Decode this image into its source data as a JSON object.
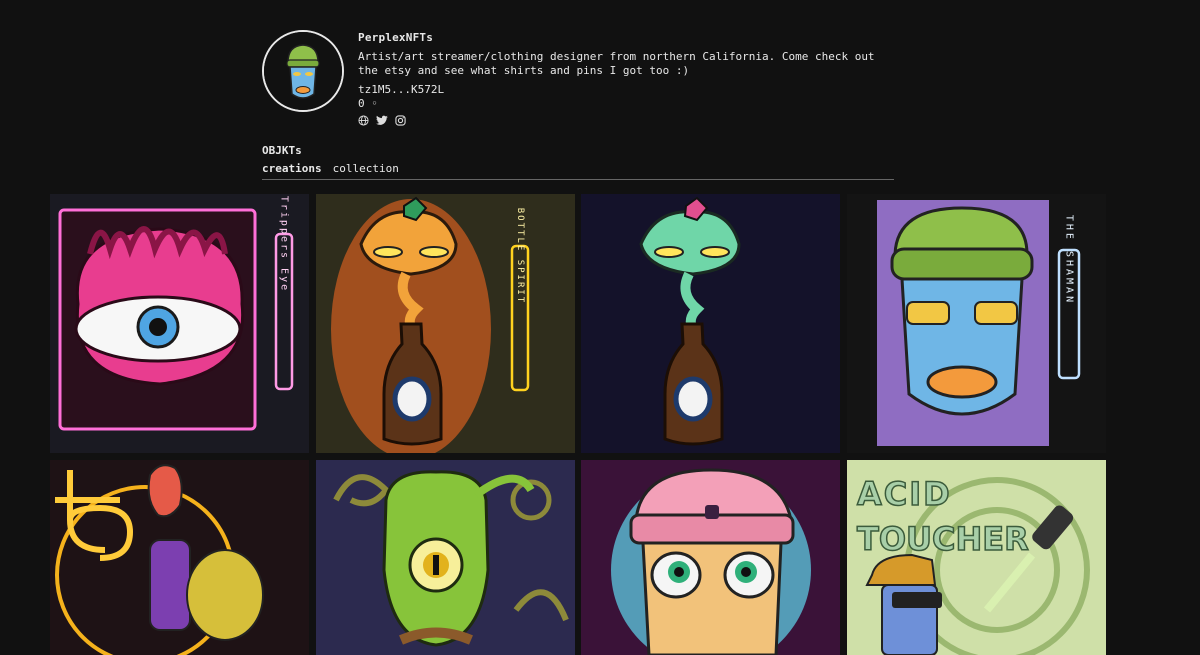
{
  "profile": {
    "name": "PerplexNFTs",
    "bio": "Artist/art streamer/clothing designer from northern California. Come check out the etsy and see what shirts and pins I got too :)",
    "wallet": "tz1M5...K572L",
    "count": "0 ◦",
    "socials": [
      {
        "name": "website",
        "icon": "globe-icon"
      },
      {
        "name": "twitter",
        "icon": "twitter-icon"
      },
      {
        "name": "instagram",
        "icon": "instagram-icon"
      }
    ]
  },
  "section_title": "OBJKTs",
  "tabs": {
    "creations": "creations",
    "collection": "collection",
    "active": "creations"
  },
  "artworks": [
    {
      "id": 1,
      "neon_text": "Trippers Eye",
      "bg": "#1a1a22",
      "accent": "#ff4fd2"
    },
    {
      "id": 2,
      "neon_text": "BOTTLE SPIRIT",
      "bg": "#2f2d1c",
      "accent": "#ffd21f"
    },
    {
      "id": 3,
      "neon_text": "",
      "bg": "#14122a",
      "accent": "#6fd6a8"
    },
    {
      "id": 4,
      "neon_text": "THE SHAMAN",
      "bg": "#141414",
      "accent": "#9ecbff"
    },
    {
      "id": 5,
      "neon_text": "",
      "bg": "#1e1215",
      "accent": "#ffcb3a"
    },
    {
      "id": 6,
      "neon_text": "",
      "bg": "#2c2a4f",
      "accent": "#87c43a"
    },
    {
      "id": 7,
      "neon_text": "",
      "bg": "#3a1238",
      "accent": "#f3a0b8"
    },
    {
      "id": 8,
      "neon_text": "ACID TOUCHER",
      "bg": "#cfe0a8",
      "accent": "#7fa04c"
    }
  ]
}
